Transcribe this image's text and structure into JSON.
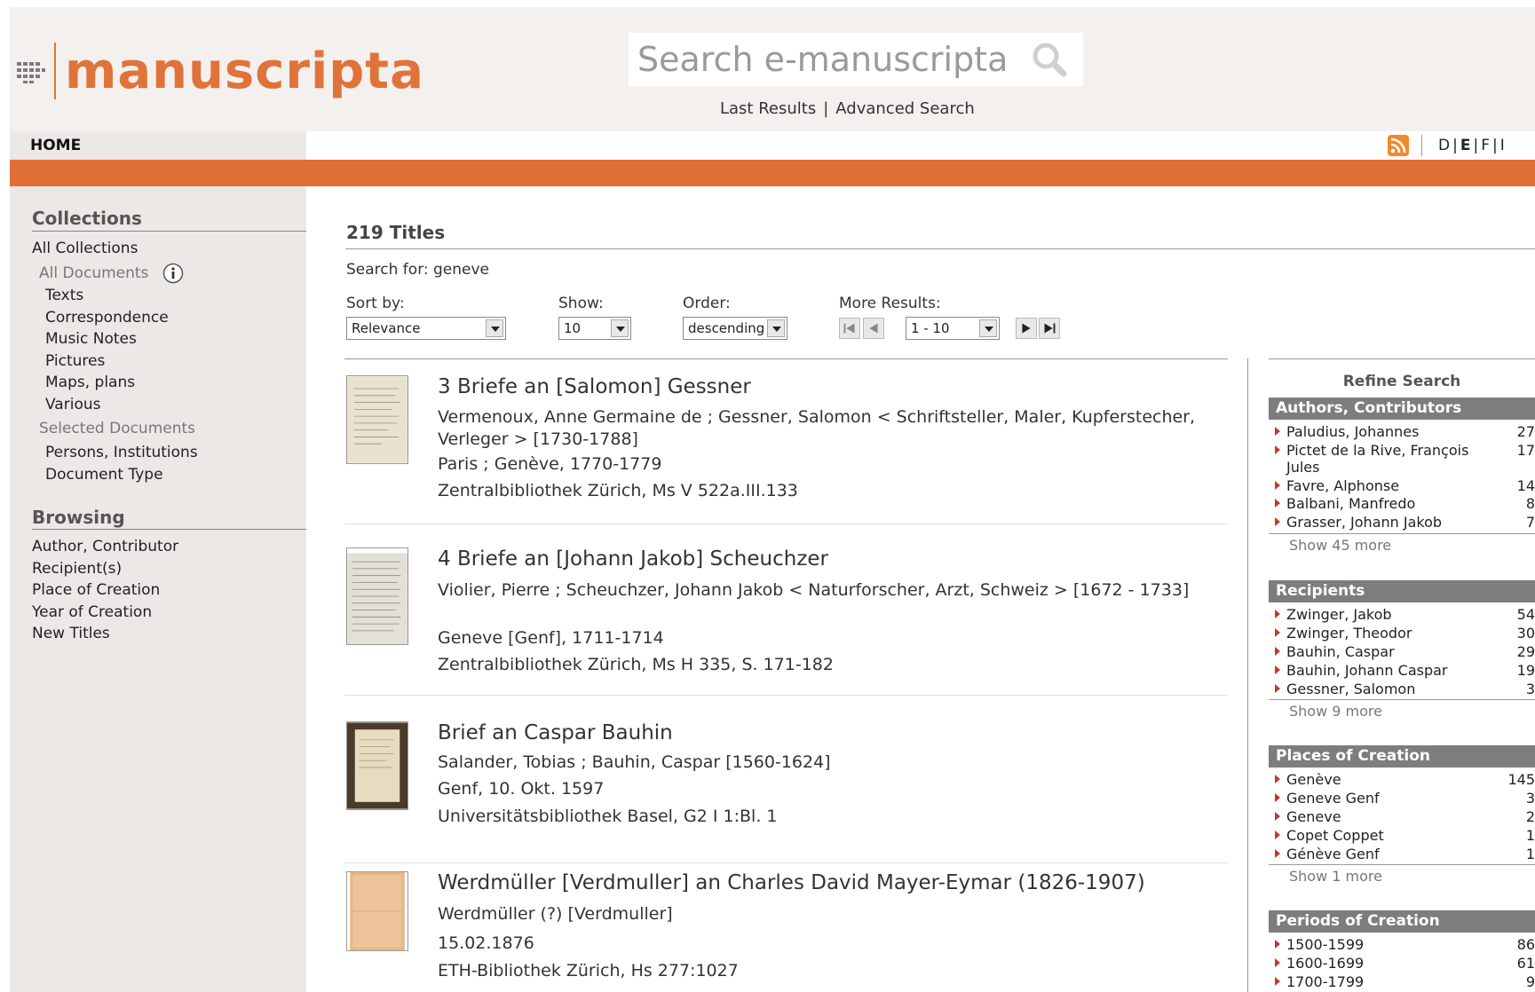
{
  "header": {
    "logo_text": "manuscripta",
    "search_placeholder": "Search e-manuscripta",
    "last_results": "Last Results",
    "link_sep": "|",
    "advanced_search": "Advanced Search"
  },
  "nav": {
    "home": "HOME",
    "languages": [
      "D",
      "E",
      "F",
      "I"
    ],
    "active_language": "E"
  },
  "colors": {
    "accent": "#e0733a",
    "facet_header": "#7d7d7d",
    "sidebar_bg": "#ece8e6"
  },
  "sidebar": {
    "collections_heading": "Collections",
    "all_collections": "All Collections",
    "all_documents": "All Documents",
    "doc_types": [
      "Texts",
      "Correspondence",
      "Music Notes",
      "Pictures",
      "Maps, plans",
      "Various"
    ],
    "selected_documents": "Selected Documents",
    "selected_items": [
      "Persons, Institutions",
      "Document Type"
    ],
    "browsing_heading": "Browsing",
    "browsing_items": [
      "Author, Contributor",
      "Recipient(s)",
      "Place of Creation",
      "Year of Creation",
      "New Titles"
    ]
  },
  "main": {
    "results_title": "219 Titles",
    "search_for": "Search for: geneve",
    "sort_label": "Sort by:",
    "sort_value": "Relevance",
    "show_label": "Show:",
    "show_value": "10",
    "order_label": "Order:",
    "order_value": "descending",
    "more_label": "More Results:",
    "range_value": "1 - 10",
    "results": [
      {
        "title": "3 Briefe an [Salomon] Gessner",
        "authors": "Vermenoux, Anne Germaine de ; Gessner, Salomon < Schriftsteller, Maler, Kupferstecher, Verleger > [1730-1788]",
        "place_date": "Paris ; Genève, 1770-1779",
        "holding": "Zentralbibliothek Zürich, Ms V 522a.III.133"
      },
      {
        "title": "4 Briefe an [Johann Jakob] Scheuchzer",
        "authors": "Violier, Pierre ; Scheuchzer, Johann Jakob < Naturforscher, Arzt, Schweiz > [1672 - 1733]",
        "place_date": "Geneve [Genf], 1711-1714",
        "holding": "Zentralbibliothek Zürich, Ms H 335, S. 171-182"
      },
      {
        "title": "Brief an Caspar Bauhin",
        "authors": "Salander, Tobias ; Bauhin, Caspar [1560-1624]",
        "place_date": "Genf, 10. Okt. 1597",
        "holding": "Universitätsbibliothek Basel, G2 I 1:Bl. 1"
      },
      {
        "title": "Werdmüller [Verdmuller] an Charles David Mayer-Eymar (1826-1907)",
        "authors": "Werdmüller (?) [Verdmuller]",
        "place_date": "15.02.1876",
        "holding": "ETH-Bibliothek Zürich, Hs 277:1027"
      }
    ]
  },
  "refine": {
    "title": "Refine Search",
    "facets": [
      {
        "heading": "Authors, Contributors",
        "items": [
          {
            "label": "Paludius, Johannes",
            "count": "27"
          },
          {
            "label": "Pictet de la Rive, François Jules",
            "count": "17"
          },
          {
            "label": "Favre, Alphonse",
            "count": "14"
          },
          {
            "label": "Balbani, Manfredo",
            "count": "8"
          },
          {
            "label": "Grasser, Johann Jakob",
            "count": "7"
          }
        ],
        "more": "Show 45 more"
      },
      {
        "heading": "Recipients",
        "items": [
          {
            "label": "Zwinger, Jakob",
            "count": "54"
          },
          {
            "label": "Zwinger, Theodor",
            "count": "30"
          },
          {
            "label": "Bauhin, Caspar",
            "count": "29"
          },
          {
            "label": "Bauhin, Johann Caspar",
            "count": "19"
          },
          {
            "label": "Gessner, Salomon",
            "count": "3"
          }
        ],
        "more": "Show 9 more"
      },
      {
        "heading": "Places of Creation",
        "items": [
          {
            "label": "Genève",
            "count": "145"
          },
          {
            "label": "Geneve Genf",
            "count": "3"
          },
          {
            "label": "Geneve",
            "count": "2"
          },
          {
            "label": "Copet Coppet",
            "count": "1"
          },
          {
            "label": "Génève Genf",
            "count": "1"
          }
        ],
        "more": "Show 1 more"
      },
      {
        "heading": "Periods of Creation",
        "items": [
          {
            "label": "1500-1599",
            "count": "86"
          },
          {
            "label": "1600-1699",
            "count": "61"
          },
          {
            "label": "1700-1799",
            "count": "9"
          }
        ],
        "more": ""
      }
    ]
  }
}
